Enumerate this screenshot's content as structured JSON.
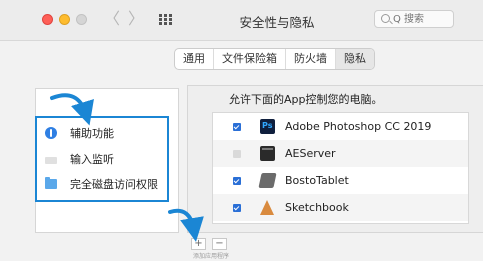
{
  "window": {
    "title": "安全性与隐私",
    "nav_back": "〈",
    "nav_forward": "〉"
  },
  "search": {
    "placeholder": "Q 搜索",
    "icon": "search-icon"
  },
  "tabs": [
    {
      "label": "通用",
      "active": false
    },
    {
      "label": "文件保险箱",
      "active": false
    },
    {
      "label": "防火墙",
      "active": false
    },
    {
      "label": "隐私",
      "active": true
    }
  ],
  "services": [
    {
      "label": "辅助功能",
      "icon": "accessibility-icon"
    },
    {
      "label": "输入监听",
      "icon": "keyboard-icon"
    },
    {
      "label": "完全磁盘访问权限",
      "icon": "folder-icon"
    }
  ],
  "right": {
    "title": "允许下面的App控制您的电脑。",
    "apps": [
      {
        "name": "Adobe Photoshop CC 2019",
        "checked": true,
        "icon": "photoshop-icon"
      },
      {
        "name": "AEServer",
        "checked": false,
        "icon": "terminal-icon"
      },
      {
        "name": "BostoTablet",
        "checked": true,
        "icon": "tablet-icon"
      },
      {
        "name": "Sketchbook",
        "checked": true,
        "icon": "sketchbook-icon"
      }
    ]
  },
  "controls": {
    "plus": "+",
    "minus": "−",
    "hint": "添加应用程序"
  },
  "colors": {
    "highlight": "#1b86d4",
    "checkbox": "#2a6fd6"
  }
}
